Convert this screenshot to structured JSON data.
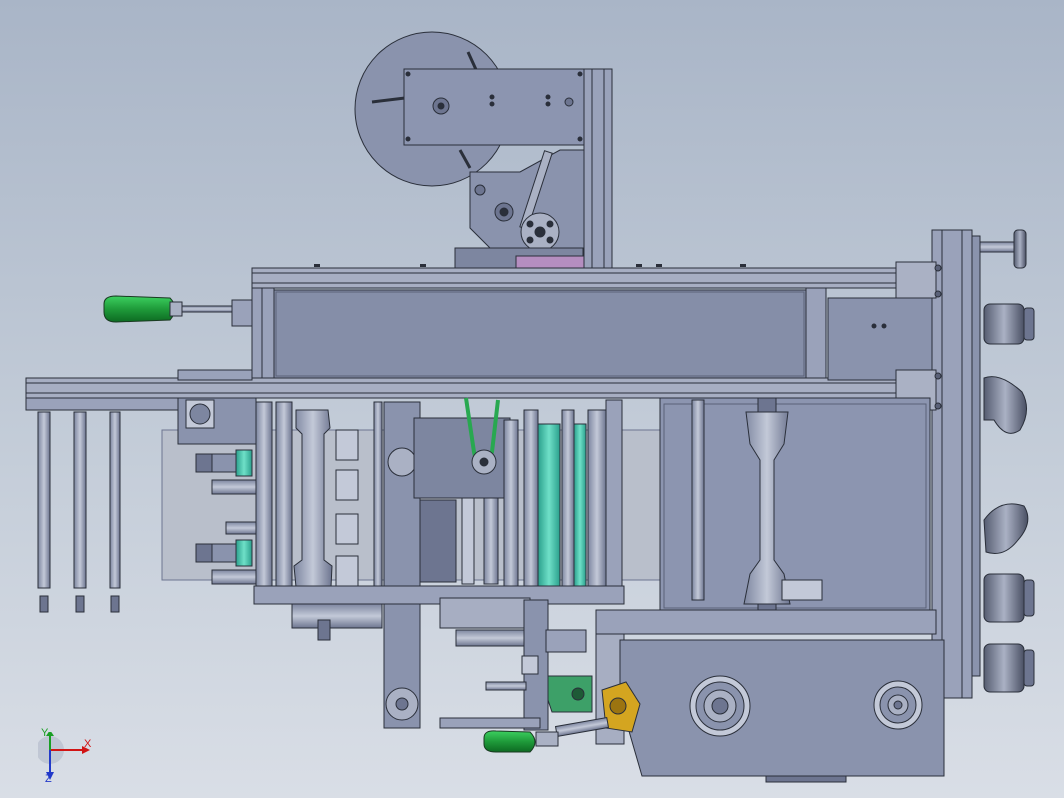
{
  "view": {
    "background_top": "#a9b5c7",
    "background_bottom": "#d9dee6",
    "part_color": "#8a93ad",
    "edge_color": "#2a2f3a",
    "handle_color": "#1f9b3a",
    "roller_color": "#38b8a0",
    "belt_color": "#28a850",
    "bracket_color": "#3da068",
    "brass_color": "#d4a520"
  },
  "triad": {
    "x_label": "X",
    "y_label": "Y",
    "z_label": "Z",
    "x_color": "#d11414",
    "y_color": "#1a9e25",
    "z_color": "#2239c9"
  }
}
